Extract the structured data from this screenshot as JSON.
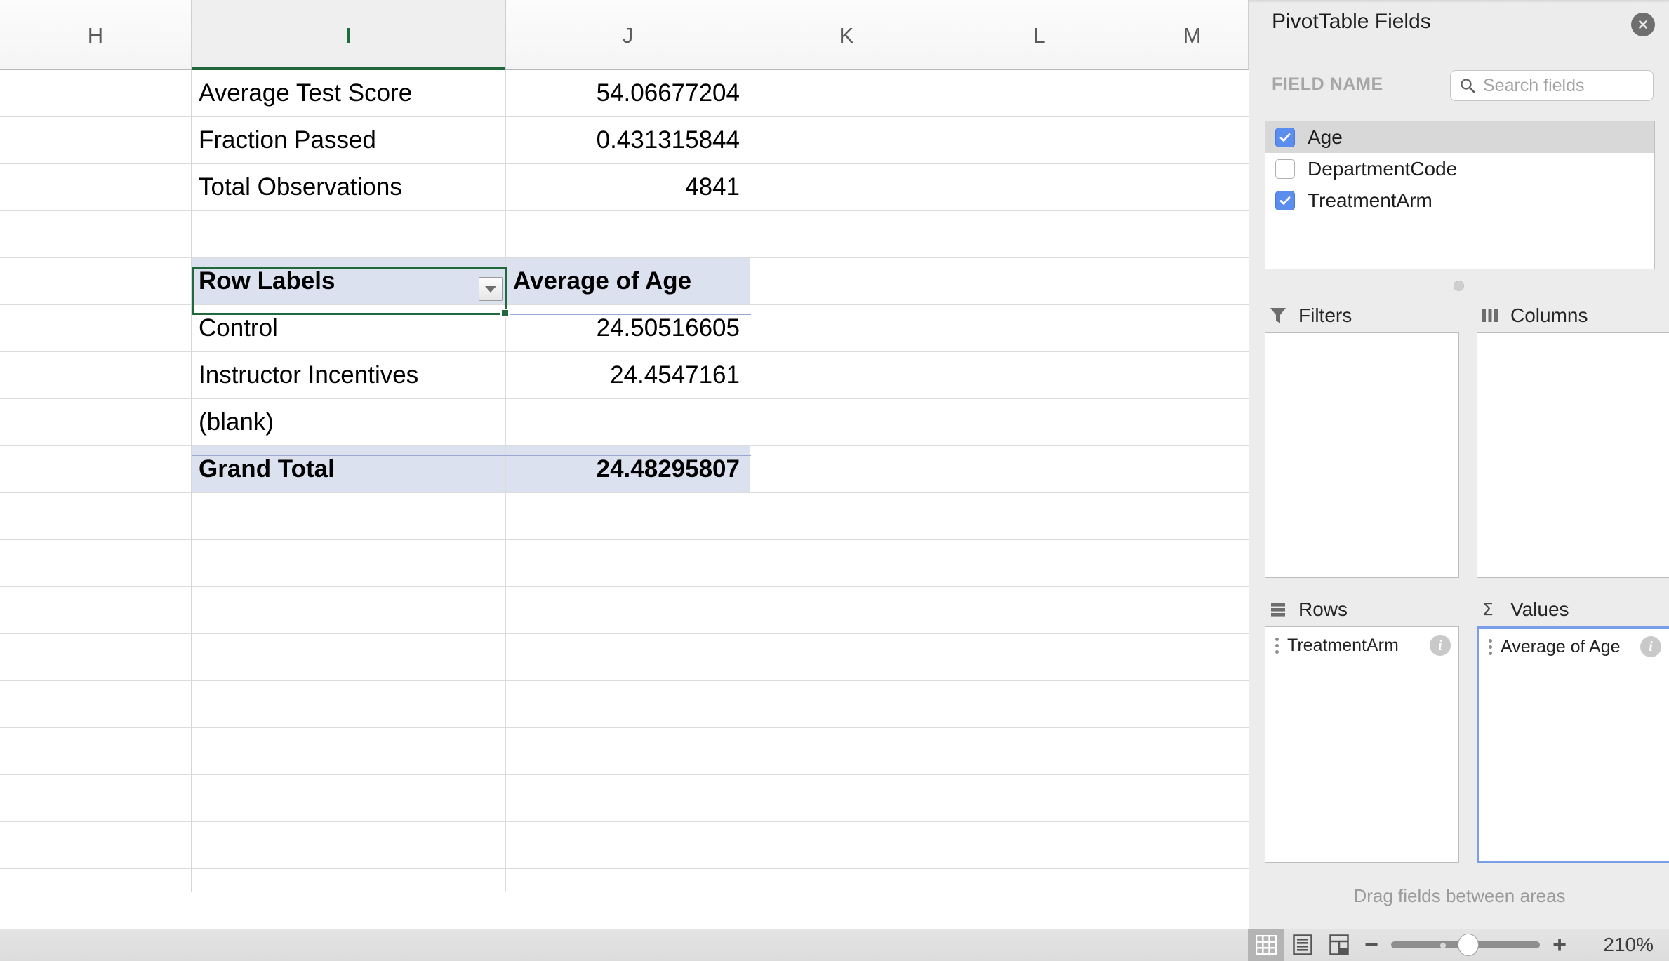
{
  "spreadsheet": {
    "columns": [
      "H",
      "I",
      "J",
      "K",
      "L",
      "M"
    ],
    "active_column": "I",
    "cells": {
      "summary": [
        {
          "label": "Average Test Score",
          "value": "54.06677204"
        },
        {
          "label": "Fraction Passed",
          "value": "0.431315844"
        },
        {
          "label": "Total Observations",
          "value": "4841"
        }
      ],
      "pivot": {
        "row_header": "Row Labels",
        "value_header": "Average of Age",
        "rows": [
          {
            "label": "Control",
            "value": "24.50516605"
          },
          {
            "label": "Instructor Incentives",
            "value": "24.4547161"
          },
          {
            "label": "(blank)",
            "value": ""
          }
        ],
        "total_label": "Grand Total",
        "total_value": "24.48295807"
      }
    },
    "selected_cell": "Row Labels",
    "filter_dropdown_icon": "chevron-down-icon"
  },
  "status_bar": {
    "views": [
      {
        "name": "normal-view",
        "icon": "grid-icon",
        "active": true
      },
      {
        "name": "page-layout-view",
        "icon": "page-layout-icon",
        "active": false
      },
      {
        "name": "page-break-view",
        "icon": "page-break-icon",
        "active": false
      }
    ],
    "zoom_out_label": "−",
    "zoom_in_label": "+",
    "zoom_level": "210%"
  },
  "pivot_panel": {
    "title": "PivotTable Fields",
    "close_icon": "close-icon",
    "field_name_label": "FIELD NAME",
    "search": {
      "icon": "search-icon",
      "placeholder": "Search fields",
      "value": ""
    },
    "fields": [
      {
        "label": "Age",
        "checked": true,
        "selected": true
      },
      {
        "label": "DepartmentCode",
        "checked": false,
        "selected": false
      },
      {
        "label": "TreatmentArm",
        "checked": true,
        "selected": false
      }
    ],
    "areas": [
      {
        "key": "filters",
        "label": "Filters",
        "icon": "funnel-icon",
        "items": [],
        "focused": false
      },
      {
        "key": "columns",
        "label": "Columns",
        "icon": "columns-icon",
        "items": [],
        "focused": false
      },
      {
        "key": "rows",
        "label": "Rows",
        "icon": "rows-icon",
        "items": [
          {
            "label": "TreatmentArm"
          }
        ],
        "focused": false
      },
      {
        "key": "values",
        "label": "Values",
        "icon": "sigma-icon",
        "items": [
          {
            "label": "Average of Age"
          }
        ],
        "focused": true
      }
    ],
    "drag_hint": "Drag fields between areas"
  },
  "colors": {
    "accent_green": "#21693c",
    "pivot_header_fill": "#dce1f0",
    "checkbox_blue": "#5b8def",
    "focus_blue": "#7b9ee8"
  }
}
